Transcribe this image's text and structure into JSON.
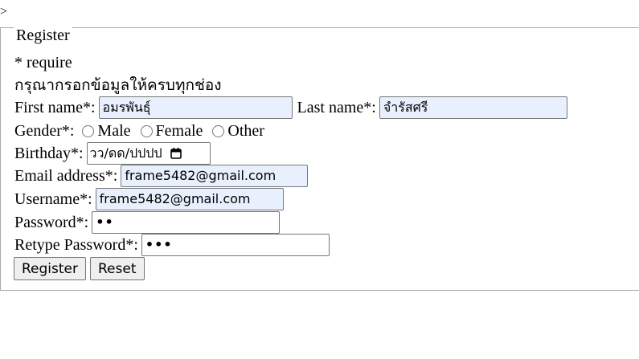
{
  "stray_text": ">",
  "form": {
    "legend": "Register",
    "require_note": "* require",
    "instruction": "กรุณากรอกข้อมูลให้ครบทุกช่อง",
    "first_name": {
      "label": "First name*:",
      "value": "อมรพันธุ์"
    },
    "last_name": {
      "label": "Last name*:",
      "value": "จำรัสศรี"
    },
    "gender": {
      "label": "Gender*:",
      "options": [
        "Male",
        "Female",
        "Other"
      ],
      "selected": null
    },
    "birthday": {
      "label": "Birthday*:",
      "placeholder": "วว/ดด/ปปปป"
    },
    "email": {
      "label": "Email address*:",
      "value": "frame5482@gmail.com"
    },
    "username": {
      "label": "Username*:",
      "value": "frame5482@gmail.com"
    },
    "password": {
      "label": "Password*:",
      "masked": "••"
    },
    "retype_password": {
      "label": "Retype Password*:",
      "masked": "•••"
    },
    "buttons": {
      "register": "Register",
      "reset": "Reset"
    }
  }
}
